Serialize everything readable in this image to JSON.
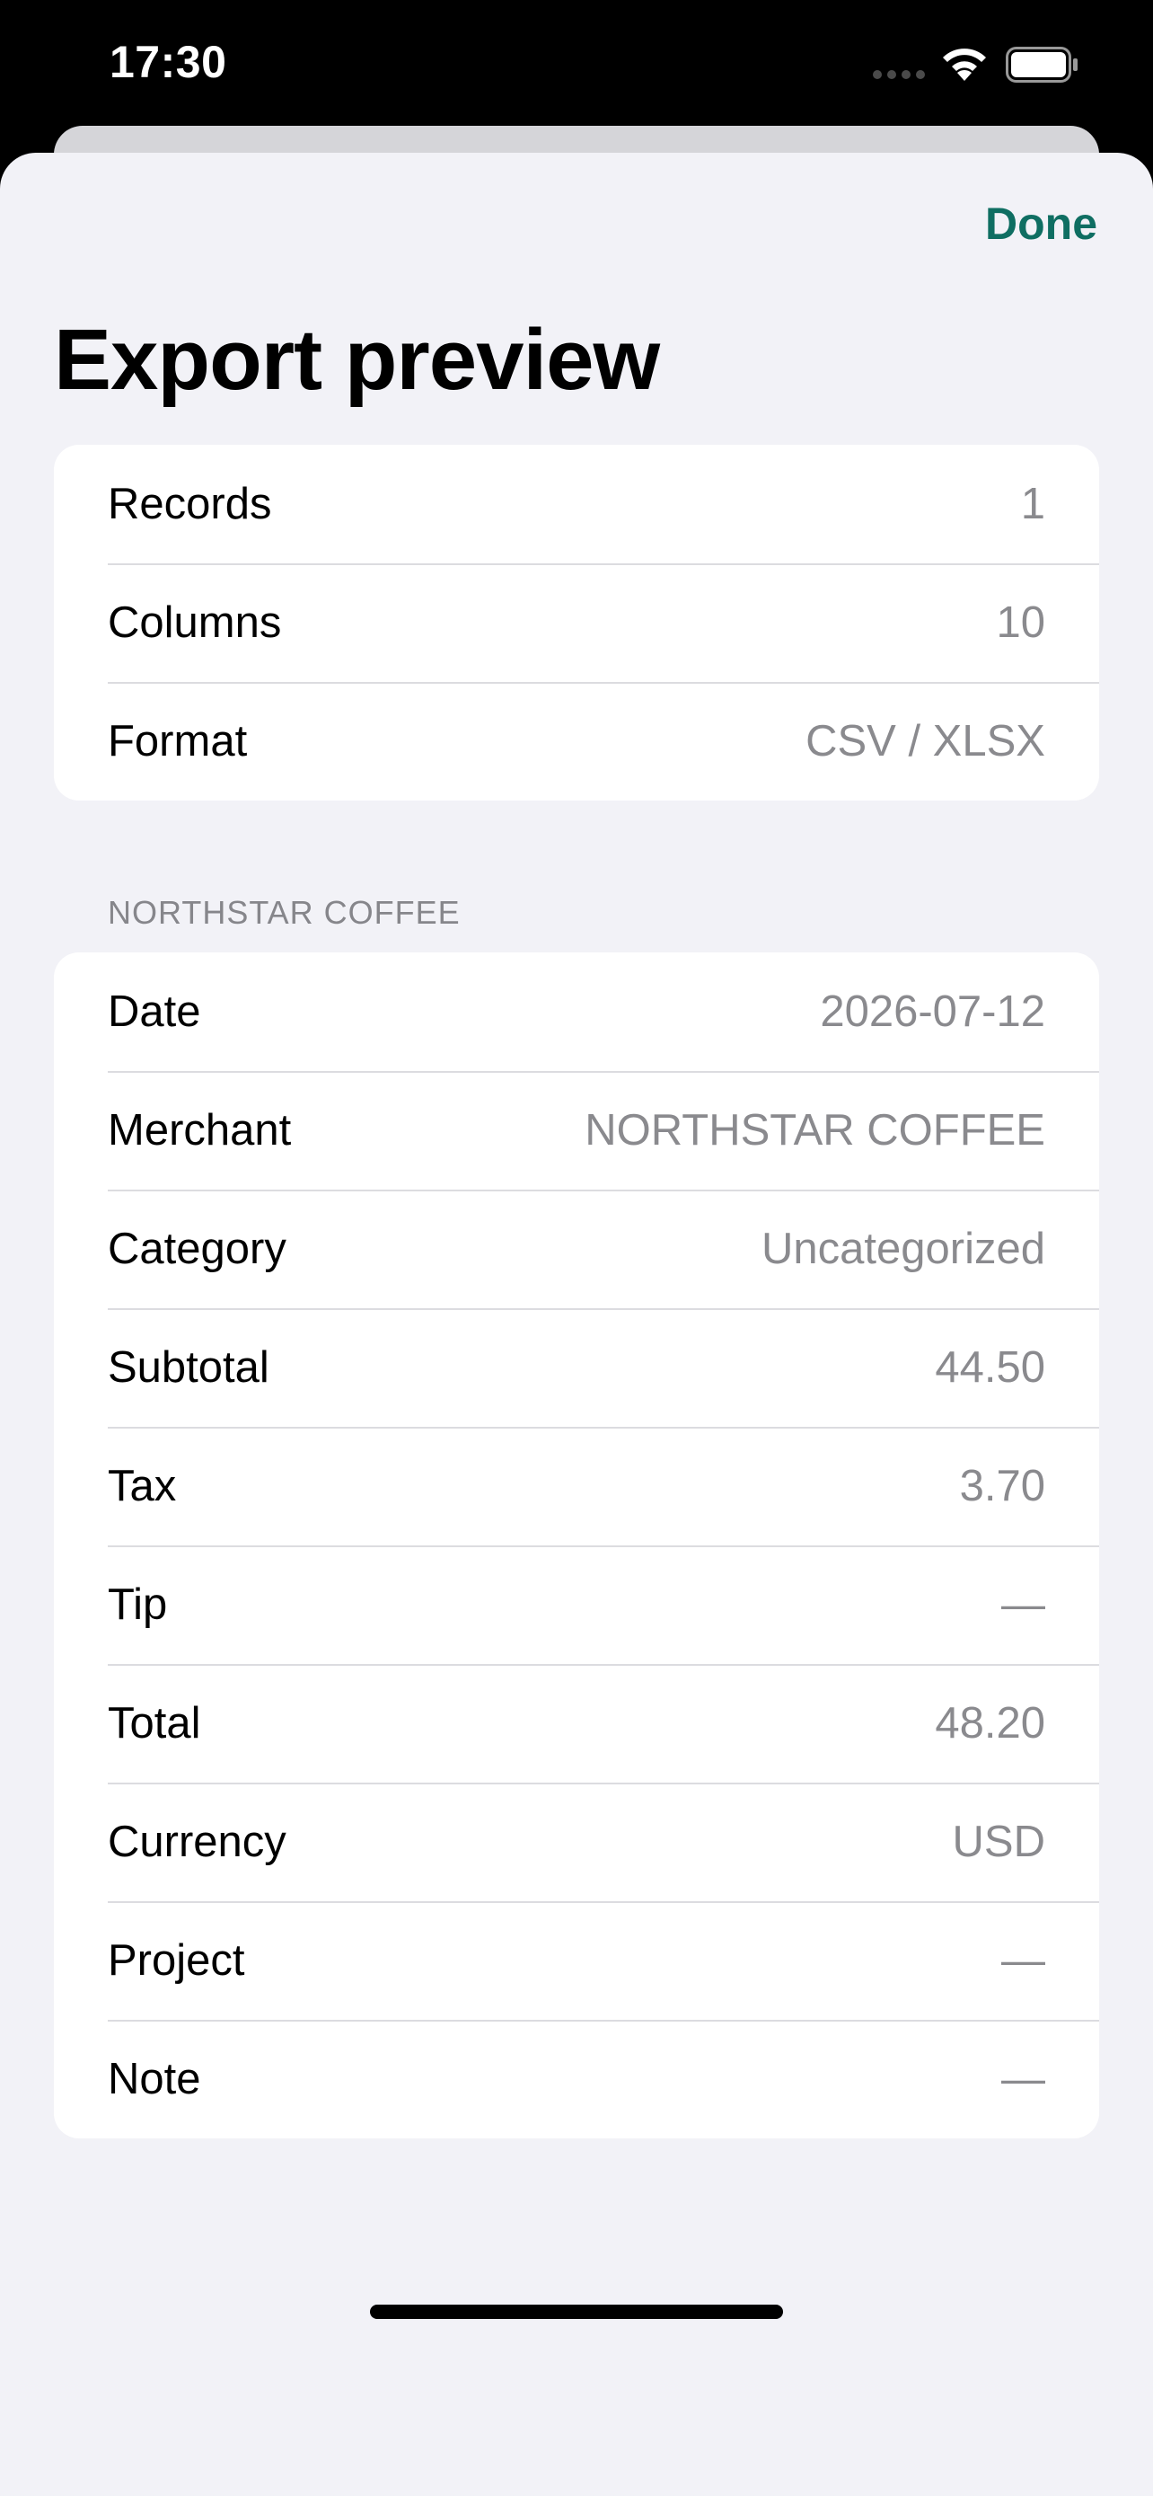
{
  "status_bar": {
    "time": "17:30"
  },
  "header": {
    "done_label": "Done",
    "title": "Export preview"
  },
  "summary": {
    "rows": [
      {
        "label": "Records",
        "value": "1"
      },
      {
        "label": "Columns",
        "value": "10"
      },
      {
        "label": "Format",
        "value": "CSV / XLSX"
      }
    ]
  },
  "receipt": {
    "section_title": "NORTHSTAR COFFEE",
    "rows": [
      {
        "label": "Date",
        "value": "2026-07-12"
      },
      {
        "label": "Merchant",
        "value": "NORTHSTAR COFFEE"
      },
      {
        "label": "Category",
        "value": "Uncategorized"
      },
      {
        "label": "Subtotal",
        "value": "44.50"
      },
      {
        "label": "Tax",
        "value": "3.70"
      },
      {
        "label": "Tip",
        "value": "—"
      },
      {
        "label": "Total",
        "value": "48.20"
      },
      {
        "label": "Currency",
        "value": "USD"
      },
      {
        "label": "Project",
        "value": "—"
      },
      {
        "label": "Note",
        "value": "—"
      }
    ]
  },
  "colors": {
    "accent": "#0f6e62",
    "background": "#f2f2f7",
    "card": "#ffffff",
    "secondary_text": "#8a8a8e"
  },
  "icons": [
    "signal-icon",
    "wifi-icon",
    "battery-icon"
  ]
}
